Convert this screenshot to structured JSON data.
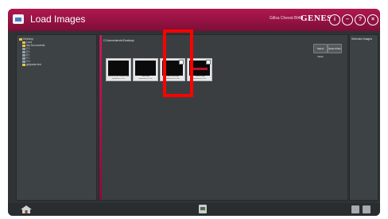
{
  "window": {
    "title": "Load Images",
    "product_name": "Gillsa Cheest Bl4Q",
    "brand": "GENESys",
    "controls": [
      {
        "label": "i",
        "icon": "info-icon"
      },
      {
        "label": "–",
        "icon": "minimize-icon"
      },
      {
        "label": "?",
        "icon": "help-icon"
      },
      {
        "label": "×",
        "icon": "close-icon"
      }
    ]
  },
  "folder_tree": {
    "items": [
      {
        "label": "Desktop",
        "icon": "folder-icon"
      },
      {
        "label": "Loot",
        "icon": "folder-icon"
      },
      {
        "label": "My Documents",
        "icon": "folder-icon"
      },
      {
        "label": "C:\\",
        "icon": "drive-icon"
      },
      {
        "label": "D:\\",
        "icon": "drive-icon"
      },
      {
        "label": "E:\\",
        "icon": "drive-icon"
      },
      {
        "label": "F:\\",
        "icon": "drive-icon"
      },
      {
        "label": "G:\\",
        "icon": "drive-icon"
      },
      {
        "label": "gelpads.test",
        "icon": "folder-icon"
      }
    ]
  },
  "browser": {
    "path": "C:\\Users\\dervin\\Desktop\\",
    "buttons": [
      {
        "label": "Select None"
      },
      {
        "label": "Select Files"
      }
    ],
    "thumbnails": [
      {
        "name": "dab1b7ff6 gel analyzer.sgd",
        "date": "26/08/2014 12:21"
      },
      {
        "name": "cams.sgd",
        "date": "26/08/2014 12:35"
      },
      {
        "name": "chemi white.sgd",
        "date": "26/08/2014 12:48"
      },
      {
        "name": "Chemi fa.sgd",
        "date": "26/08/2014 12:57"
      }
    ]
  },
  "selected_panel": {
    "title": "Selected Images"
  },
  "colors": {
    "titlebar": "#a01445",
    "accent": "#c81a5c",
    "highlight": "#ff0000",
    "panel": "#3d4245"
  }
}
